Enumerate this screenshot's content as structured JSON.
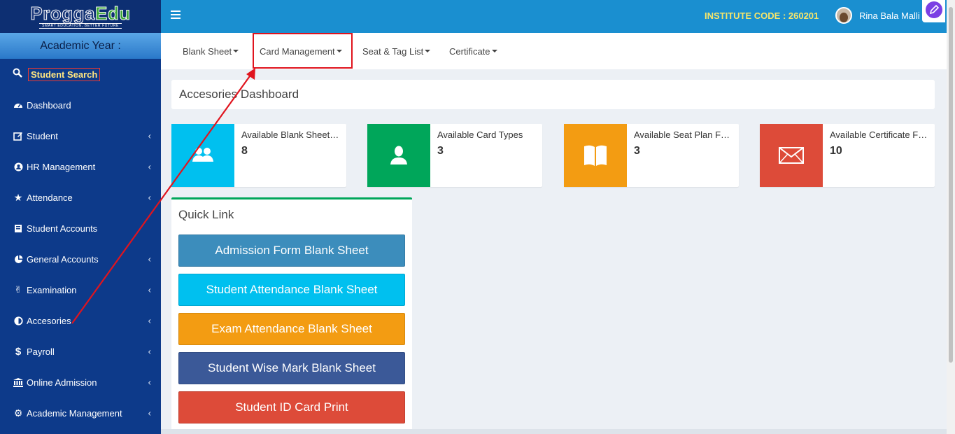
{
  "logo": {
    "text_part1": "Progga",
    "text_part2": "Edu",
    "tagline": "SMART EDUCATION, BETTER FUTURE"
  },
  "sidebar": {
    "academic_year_label": "Academic Year :",
    "search_label": "Student Search",
    "items": [
      {
        "label": "Dashboard",
        "icon": "dashboard-icon",
        "has_chevron": false
      },
      {
        "label": "Student",
        "icon": "edit-icon",
        "has_chevron": true
      },
      {
        "label": "HR Management",
        "icon": "hr-icon",
        "has_chevron": true
      },
      {
        "label": "Attendance",
        "icon": "star-icon",
        "has_chevron": true
      },
      {
        "label": "Student Accounts",
        "icon": "ledger-icon",
        "has_chevron": true
      },
      {
        "label": "General Accounts",
        "icon": "pie-chart-icon",
        "has_chevron": true
      },
      {
        "label": "Examination",
        "icon": "victory-hand-icon",
        "has_chevron": true
      },
      {
        "label": "Accesories",
        "icon": "half-circle-icon",
        "has_chevron": true
      },
      {
        "label": "Payroll",
        "icon": "dollar-icon",
        "has_chevron": true
      },
      {
        "label": "Online Admission",
        "icon": "bank-icon",
        "has_chevron": true
      },
      {
        "label": "Academic Management",
        "icon": "gear-icon",
        "has_chevron": true
      }
    ]
  },
  "header": {
    "institute_code": "INSTITUTE CODE : 260201",
    "user_name": "Rina Bala Malli"
  },
  "tabs": [
    {
      "label": "Blank Sheet"
    },
    {
      "label": "Card Management"
    },
    {
      "label": "Seat & Tag List"
    },
    {
      "label": "Certificate"
    }
  ],
  "dashboard": {
    "title": "Accesories Dashboard",
    "info_boxes": [
      {
        "text": "Available Blank Sheet…",
        "value": "8",
        "color": "#00c0ef",
        "icon": "users-icon"
      },
      {
        "text": "Available Card Types",
        "value": "3",
        "color": "#00a65a",
        "icon": "user-icon"
      },
      {
        "text": "Available Seat Plan F…",
        "value": "3",
        "color": "#f39c12",
        "icon": "book-icon"
      },
      {
        "text": "Available Certificate F…",
        "value": "10",
        "color": "#dd4b39",
        "icon": "envelope-icon"
      }
    ]
  },
  "quick_link": {
    "title": "Quick Link",
    "buttons": [
      {
        "label": "Admission Form Blank Sheet",
        "color": "#3c8dbc"
      },
      {
        "label": "Student Attendance Blank Sheet",
        "color": "#00c0ef"
      },
      {
        "label": "Exam Attendance Blank Sheet",
        "color": "#f39c12"
      },
      {
        "label": "Student Wise Mark Blank Sheet",
        "color": "#3b5998"
      },
      {
        "label": "Student ID Card Print",
        "color": "#dd4b39"
      }
    ]
  },
  "colors": {
    "sidebar_bg": "#0d3a8a",
    "topbar_bg": "#1a8fd0",
    "annotation_red": "#e0141e"
  }
}
